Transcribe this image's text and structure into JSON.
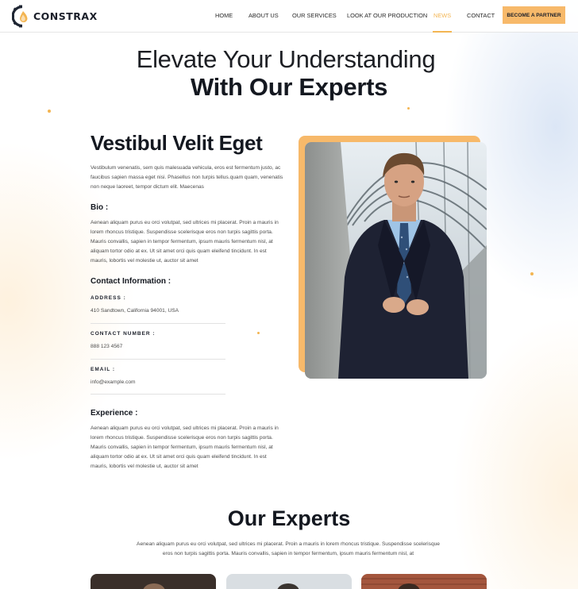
{
  "brand": {
    "name": "CONSTRAX",
    "accent": "#f3b552",
    "cta_color": "#f7b96a"
  },
  "nav": {
    "items": [
      {
        "label": "HOME"
      },
      {
        "label": "ABOUT US"
      },
      {
        "label": "OUR SERVICES"
      },
      {
        "label": "LOOK AT OUR PRODUCTION"
      },
      {
        "label": "NEWS",
        "active": true
      },
      {
        "label": "CONTACT"
      }
    ],
    "cta": "BECOME A PARTNER"
  },
  "hero": {
    "line1": "Elevate Your Understanding",
    "line2": "With Our Experts"
  },
  "profile": {
    "name": "Vestibul Velit Eget",
    "intro": "Vestibulum venenatis, sem quis malesuada vehicula, eros est fermentum justo, ac faucibus sapien massa eget nisi. Phasellus non turpis tellus.quam quam, venenatis non neque laoreet, tempor dictum elit. Maecenas",
    "bio_heading": "Bio :",
    "bio": "Aenean aliquam purus eu orci volutpat, sed ultrices mi placerat. Proin a mauris in lorem rhoncus tristique. Suspendisse scelerisque eros non turpis sagittis porta. Mauris convallis, sapien in tempor fermentum, ipsum mauris fermentum nisl, at aliquam tortor odio at ex. Ut sit amet orci quis quam eleifend tincidunt. In est mauris, lobortis vel molestie ut, auctor sit amet",
    "contact_heading": "Contact Information :",
    "address_label": "ADDRESS :",
    "address": "410 Sandtown, California 94001, USA",
    "phone_label": "CONTACT NUMBER :",
    "phone": "888 123 4567",
    "email_label": "EMAIL :",
    "email": "info@example.com",
    "experience_heading": "Experience :",
    "experience": "Aenean aliquam purus eu orci volutpat, sed ultrices mi placerat. Proin a mauris in lorem rhoncus tristique. Suspendisse scelerisque eros non turpis sagittis porta. Mauris convallis, sapien in tempor fermentum, ipsum mauris fermentum nisl, at aliquam tortor odio at ex. Ut sit amet orci quis quam eleifend tincidunt. In est mauris, lobortis vel molestie ut, auctor sit amet"
  },
  "experts": {
    "title": "Our Experts",
    "text": "Aenean aliquam purus eu orci volutpat, sed ultrices mi placerat. Proin a mauris in lorem rhoncus tristique. Suspendisse scelerisque eros non turpis sagittis porta. Mauris convallis, sapien in tempor fermentum, ipsum mauris fermentum nisl, at"
  },
  "icons": [
    "logo-gear-icon"
  ]
}
